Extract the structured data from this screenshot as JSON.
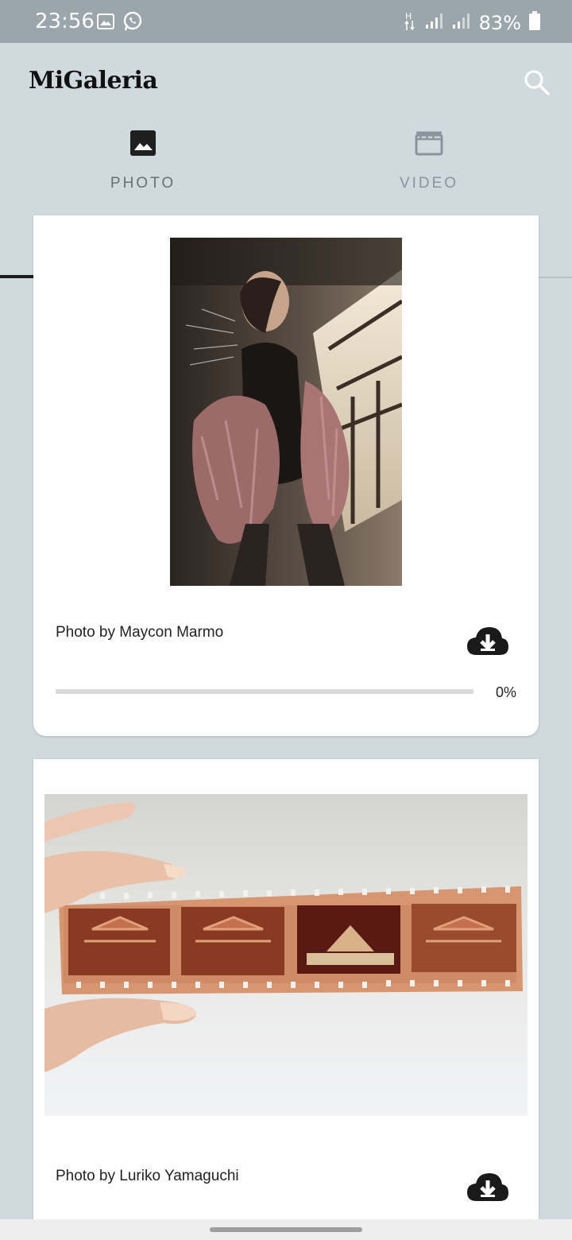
{
  "status_bar": {
    "time": "23:56",
    "battery_percent": "83%",
    "icons": [
      "image-icon",
      "whatsapp-icon",
      "data-h-icon",
      "signal-icon",
      "signal-icon",
      "battery-icon"
    ]
  },
  "app": {
    "title": "MiGaleria",
    "search_icon": "search-icon"
  },
  "tabs": [
    {
      "label": "PHOTO",
      "icon": "image-icon",
      "selected": true
    },
    {
      "label": "VIDEO",
      "icon": "clapperboard-icon",
      "selected": false
    }
  ],
  "photos": [
    {
      "caption": "Photo by Maycon Marmo",
      "download_icon": "cloud-download-icon",
      "progress": 0,
      "progress_text": "0%"
    },
    {
      "caption": "Photo by Luriko Yamaguchi",
      "download_icon": "cloud-download-icon"
    }
  ],
  "colors": {
    "background": "#cfd9de",
    "status_bar": "#9aa6ac",
    "card": "#ffffff",
    "tab_indicator": "#1a1a1a"
  }
}
